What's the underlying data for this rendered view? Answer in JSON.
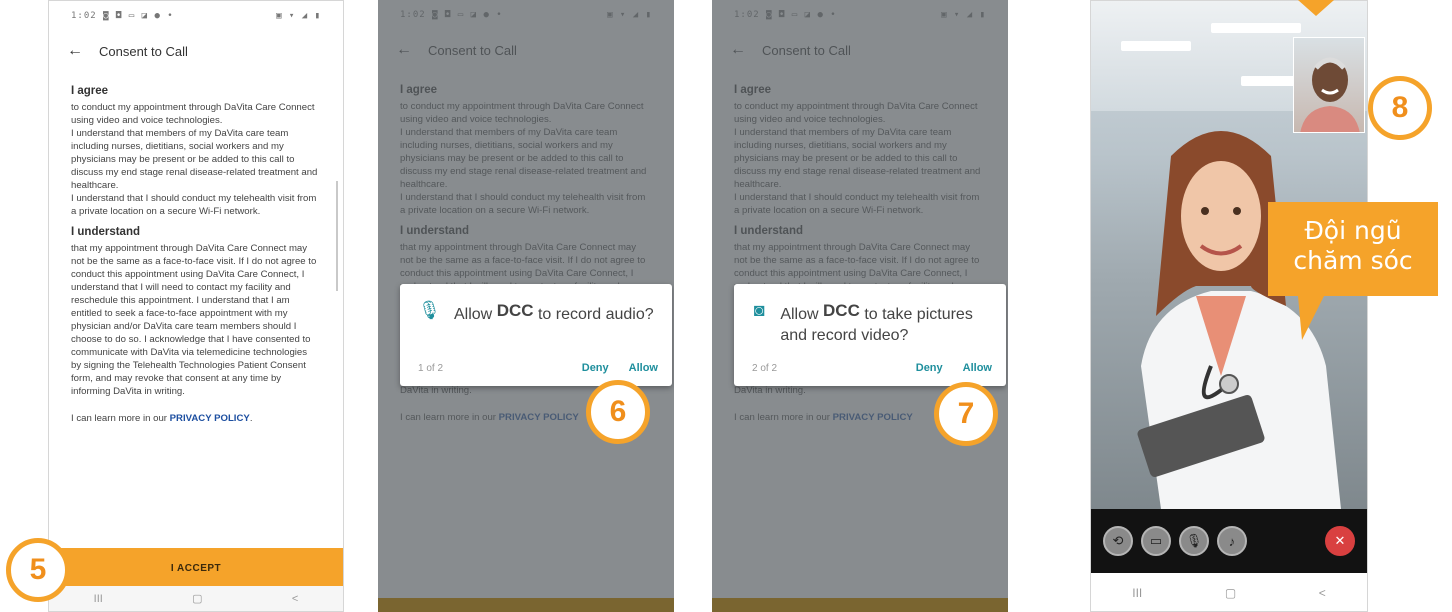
{
  "status_bar": {
    "left": "1:02 ◙ ◘ ▭ ◪ ● •",
    "right": "▣ ▾ ◢ ▮"
  },
  "screen": {
    "title": "Consent to Call",
    "section1_heading": "I agree",
    "section1_text": "to conduct my appointment through DaVita Care Connect using video and voice technologies.\nI understand that members of my DaVita care team including nurses, dietitians, social workers and my physicians may be present or be added to this call to discuss my end stage renal disease-related treatment and healthcare.\nI understand that I should conduct my telehealth visit from a private location on a secure Wi-Fi network.",
    "section2_heading": "I understand",
    "section2_text": "that my appointment through DaVita Care Connect may not be the same as a face-to-face visit. If I do not agree to conduct this appointment using DaVita Care Connect, I understand that I will need to contact my facility and reschedule this appointment. I understand that I am entitled to seek a face-to-face appointment with my physician and/or DaVita care team members should I choose to do so. I acknowledge that I have consented to communicate with DaVita via telemedicine technologies by signing the Telehealth Technologies Patient Consent form, and may revoke that consent at any time by informing DaVita in writing.",
    "learn_prefix": "I can learn more in our ",
    "privacy_link": "PRIVACY POLICY",
    "learn_suffix": ".",
    "accept_button": "I ACCEPT"
  },
  "nav_bar": {
    "recent": "III",
    "home": "▢",
    "back": "<"
  },
  "dialog_audio": {
    "prefix": "Allow",
    "app": "DCC",
    "text": "to record audio?",
    "counter": "1 of 2",
    "deny": "Deny",
    "allow": "Allow"
  },
  "dialog_video": {
    "prefix": "Allow",
    "app": "DCC",
    "text": "to take pictures and record video?",
    "counter": "2 of 2",
    "deny": "Deny",
    "allow": "Allow"
  },
  "steps": {
    "five": "5",
    "six": "6",
    "seven": "7",
    "eight": "8"
  },
  "callout": {
    "line1": "Đội ngũ",
    "line2": "chăm sóc"
  },
  "colors": {
    "accent": "#f5a32a",
    "dialog_accent": "#1f8f9d",
    "link": "#1d4fa0",
    "end_call": "#d94040"
  }
}
